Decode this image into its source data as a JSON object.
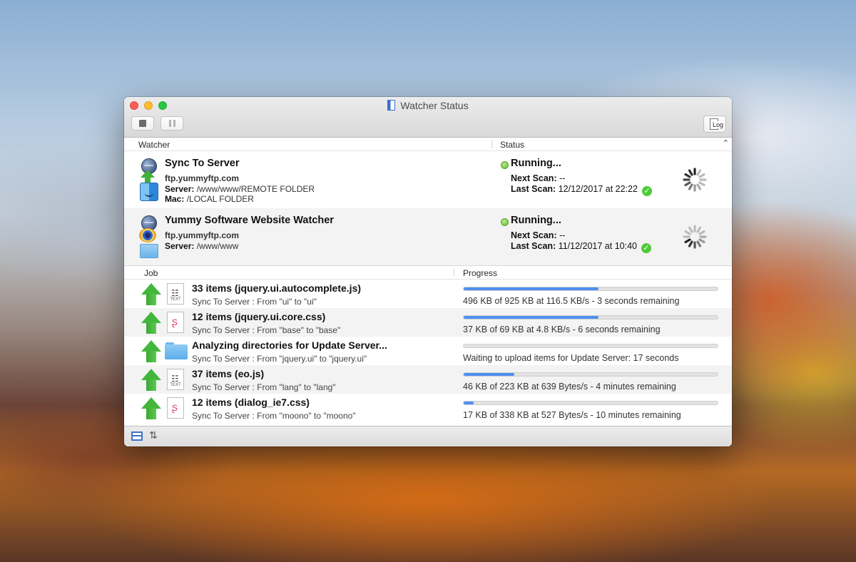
{
  "window": {
    "title": "Watcher Status",
    "log_button": "Log"
  },
  "watcher_table": {
    "col_watcher": "Watcher",
    "col_status": "Status",
    "watchers": [
      {
        "name": "Sync To Server",
        "host": "ftp.yummyftp.com",
        "server_label": "Server:",
        "server_path": "/www/www/REMOTE FOLDER",
        "mac_label": "Mac:",
        "mac_path": "/LOCAL FOLDER",
        "status": "Running...",
        "next_scan_label": "Next Scan:",
        "next_scan": "--",
        "last_scan_label": "Last Scan:",
        "last_scan": "12/12/2017 at 22:22"
      },
      {
        "name": "Yummy Software Website Watcher",
        "host": "ftp.yummyftp.com",
        "server_label": "Server:",
        "server_path": "/www/www",
        "status": "Running...",
        "next_scan_label": "Next Scan:",
        "next_scan": "--",
        "last_scan_label": "Last Scan:",
        "last_scan": "11/12/2017 at 10:40"
      }
    ]
  },
  "job_table": {
    "col_job": "Job",
    "col_progress": "Progress",
    "jobs": [
      {
        "title": "33 items (jquery.ui.autocomplete.js)",
        "subtitle": "Sync To Server : From \"ui\" to \"ui\"",
        "progress": 0.53,
        "progress_text": "496 KB of 925 KB at 116.5 KB/s - 3 seconds remaining",
        "file_icon": "text-file-icon"
      },
      {
        "title": "12 items (jquery.ui.core.css)",
        "subtitle": "Sync To Server : From \"base\" to \"base\"",
        "progress": 0.53,
        "progress_text": "37 KB of 69 KB at 4.8 KB/s - 6 seconds remaining",
        "file_icon": "css-file-icon"
      },
      {
        "title": "Analyzing directories for Update Server...",
        "subtitle": "Sync To Server : From \"jquery.ui\" to \"jquery.ui\"",
        "progress": 0,
        "progress_text": "Waiting to upload items for Update Server: 17 seconds",
        "file_icon": "folder-icon"
      },
      {
        "title": "37 items (eo.js)",
        "subtitle": "Sync To Server : From \"lang\" to \"lang\"",
        "progress": 0.2,
        "progress_text": "46 KB of 223 KB at 639 Bytes/s - 4 minutes remaining",
        "file_icon": "text-file-icon"
      },
      {
        "title": "12 items (dialog_ie7.css)",
        "subtitle": "Sync To Server : From \"moono\" to \"moono\"",
        "progress": 0.04,
        "progress_text": "17 KB of 338 KB at 527 Bytes/s - 10 minutes remaining",
        "file_icon": "css-file-icon"
      }
    ]
  },
  "colors": {
    "progress_fill": "#4f8ff0",
    "status_green": "#61bd2c",
    "upload_arrow": "#43b63c"
  }
}
